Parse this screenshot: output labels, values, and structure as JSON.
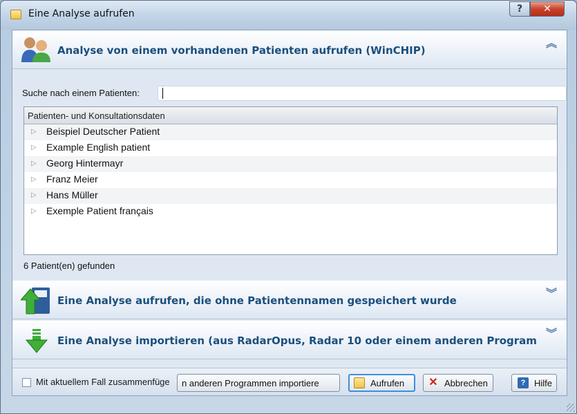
{
  "window": {
    "title": "Eine Analyse aufrufen"
  },
  "section_patient": {
    "title": "Analyse von einem vorhandenen Patienten aufrufen (WinCHIP)",
    "search_label": "Suche nach einem Patienten:",
    "search_value": "",
    "tree_header": "Patienten- und Konsultationsdaten",
    "patients": [
      "Beispiel Deutscher Patient",
      "Example English patient",
      "Georg Hintermayr",
      "Franz Meier",
      "Hans Müller",
      "Exemple Patient français"
    ],
    "count_text": "6 Patient(en) gefunden"
  },
  "section_unnamed": {
    "title": "Eine Analyse aufrufen, die ohne Patientennamen gespeichert wurde"
  },
  "section_import": {
    "title": "Eine Analyse importieren (aus RadarOpus, Radar 10 oder einem anderen Program"
  },
  "footer": {
    "merge_checkbox_label": "Mit aktuellem Fall zusammenfüge",
    "import_button": "n anderen Programmen importiere",
    "open_button": "Aufrufen",
    "cancel_button": "Abbrechen",
    "help_button": "Hilfe"
  }
}
